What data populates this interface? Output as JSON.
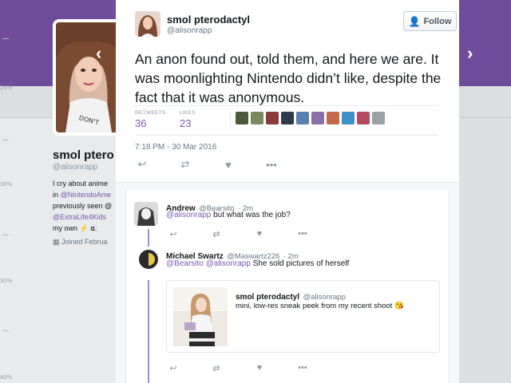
{
  "background": {
    "ruler_labels": [
      "20%",
      "30%",
      "30%",
      "30%",
      "40%"
    ],
    "profile": {
      "name": "smol ptero",
      "handle": "@alisonrapp",
      "bio_line1": "I cry about anime",
      "bio_line2_prefix": "in ",
      "bio_line2_link": "@NintendoAme",
      "bio_line3": "previously seen @",
      "bio_line4_link": "@ExtraLife4Kids",
      "bio_line5": "my own ⚡ ⍺ː",
      "joined": "Joined Februa"
    },
    "prev_arrow": "‹",
    "next_arrow": "›"
  },
  "tweet": {
    "author_name": "smol pterodactyl",
    "author_handle": "@alisonrapp",
    "follow_label": "Follow",
    "text": "An anon found out, told them, and here we are. It was moonlighting Nintendo didn’t like, despite the fact that it was anonymous.",
    "retweets_label": "RETWEETS",
    "retweets_count": "36",
    "likes_label": "LIKES",
    "likes_count": "23",
    "timestamp": "7:18 PM - 30 Mar 2016",
    "liker_colors": [
      "#4a5a3a",
      "#7b8a5e",
      "#8c3b3b",
      "#2c3a4a",
      "#5a7fb0",
      "#8a6fa8",
      "#c26a4a",
      "#3f8fc9",
      "#b54a63",
      "#9aa0a6"
    ]
  },
  "replies": [
    {
      "name": "Andrew",
      "handle": "@Bearsito",
      "time": "· 2m",
      "mention": "@alisonrapp",
      "text": " but what was the job?"
    },
    {
      "name": "Michael Swartz",
      "handle": "@Maswartz226",
      "time": "· 2m",
      "mention": "@Bearsito @alisonrapp",
      "text": " She sold pictures of herself",
      "quote": {
        "name": "smol pterodactyl",
        "handle": "@alisonrapp",
        "text": "mini, low-res sneak peek from my recent shoot 😘"
      }
    }
  ],
  "icons": {
    "reply": "reply-icon",
    "retweet": "retweet-icon",
    "like": "heart-icon",
    "more": "more-icon"
  },
  "colors": {
    "accent": "#7a58b0",
    "banner": "#6f4b9c"
  }
}
